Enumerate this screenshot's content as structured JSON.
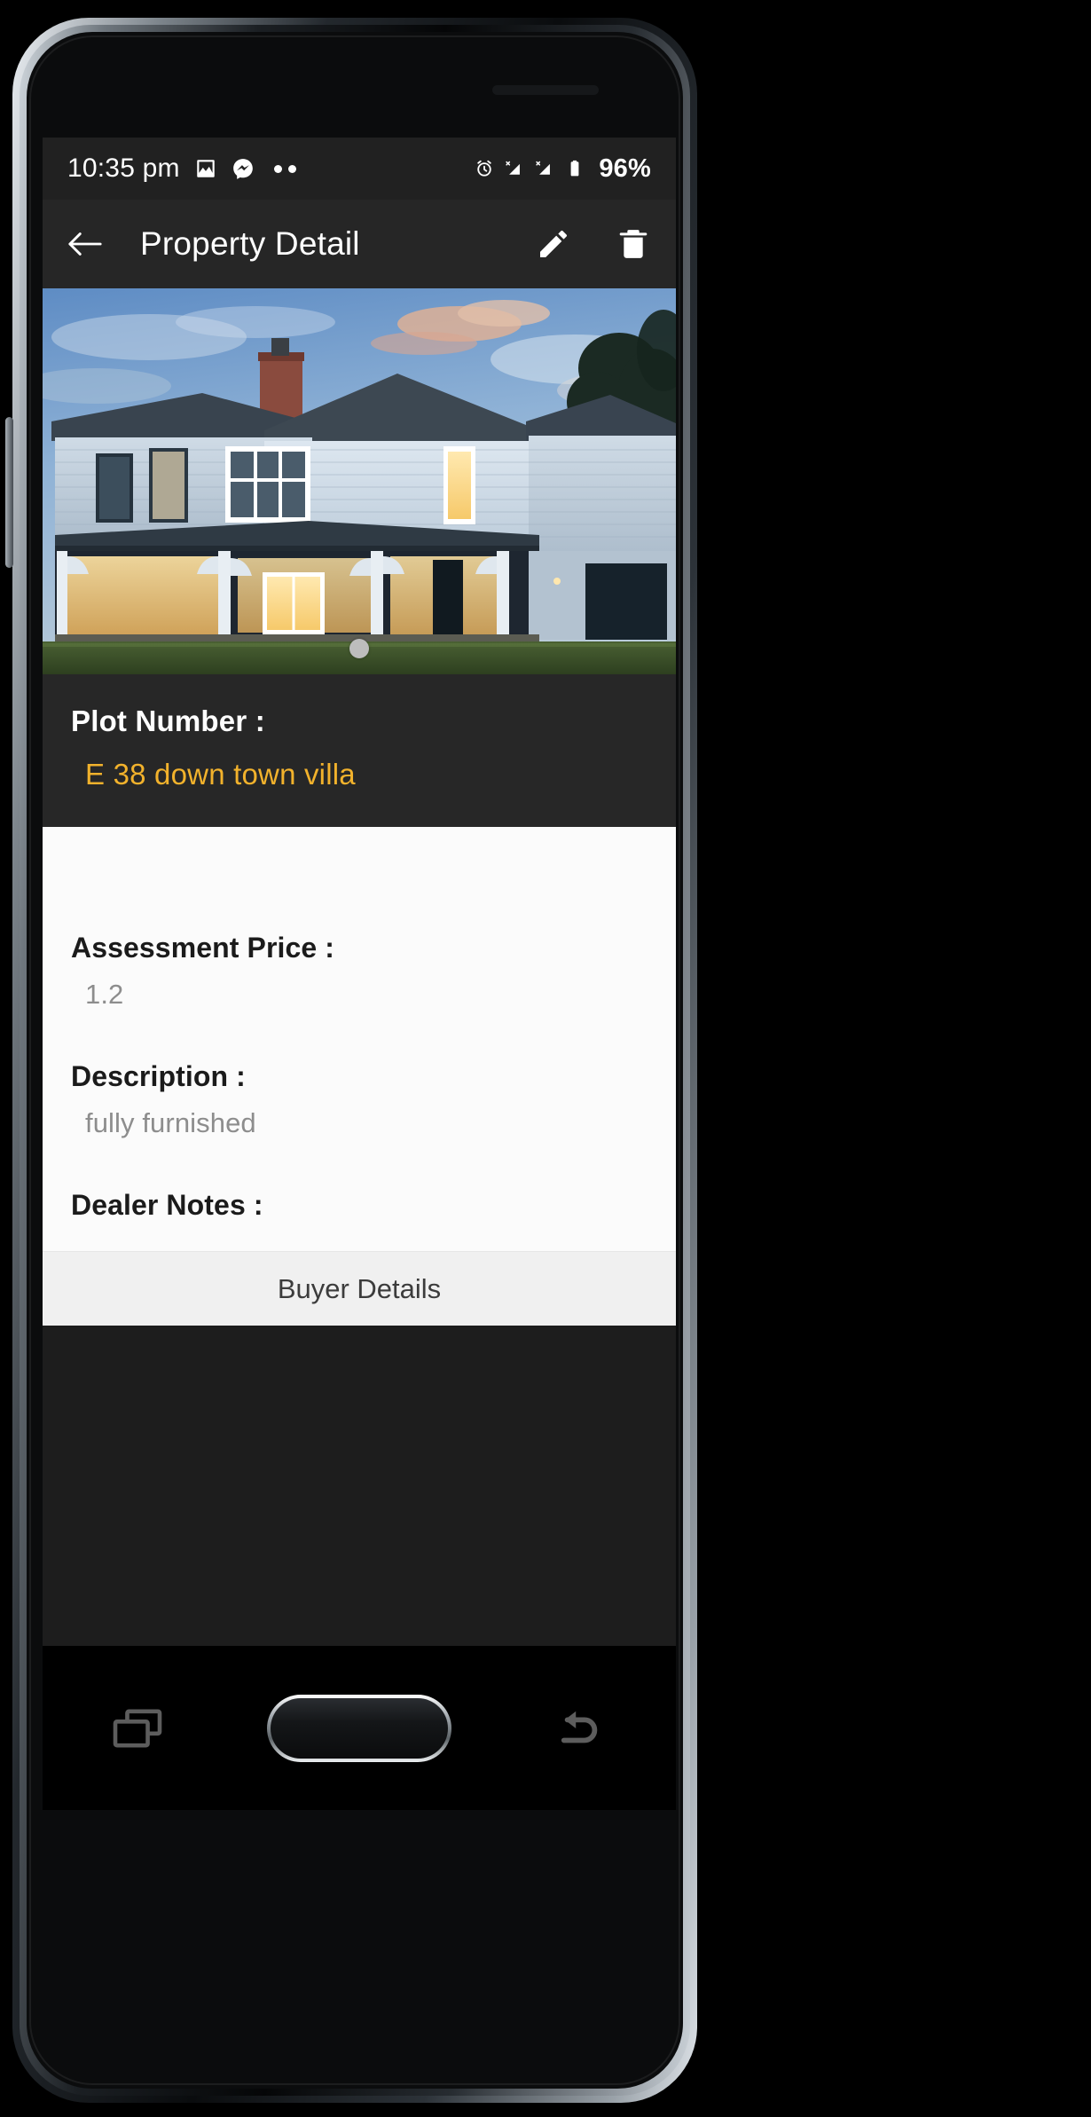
{
  "status_bar": {
    "time": "10:35 pm",
    "battery_percent": "96%",
    "icons": [
      "gallery-icon",
      "messenger-icon",
      "more-dots-icon",
      "alarm-icon",
      "signal-no-sim-icon-1",
      "signal-no-sim-icon-2",
      "battery-icon"
    ]
  },
  "app_bar": {
    "title": "Property Detail",
    "back_icon": "back-arrow-icon",
    "edit_icon": "pencil-icon",
    "delete_icon": "trash-icon"
  },
  "hero": {
    "alt": "Two storey blue weatherboard villa at dusk with lit windows",
    "page_indicator_count": 1,
    "active_page": 1
  },
  "plot": {
    "label": "Plot Number :",
    "value": "E 38 down town villa",
    "value_color": "#f2b22c",
    "background": "#272727"
  },
  "details": {
    "fields": [
      {
        "label": "Assessment Price :",
        "value": "1.2"
      },
      {
        "label": "Description :",
        "value": "fully furnished"
      },
      {
        "label": "Dealer Notes :",
        "value": "..."
      }
    ]
  },
  "buyer_button": {
    "label": "Buyer Details"
  },
  "nav_bar": {
    "recents_icon": "recent-apps-icon",
    "home_button": "home-button",
    "back_icon": "nav-back-icon"
  },
  "theme": {
    "appbar_bg": "#262626",
    "statusbar_bg": "#212121",
    "card_bg": "#fbfbfb",
    "accent": "#f2b22c"
  }
}
